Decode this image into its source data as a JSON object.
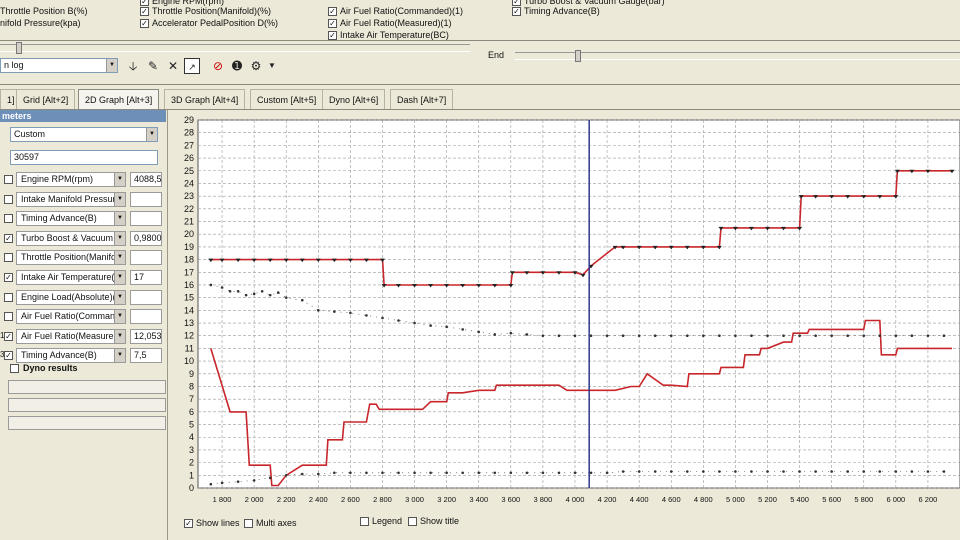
{
  "header_channels": [
    {
      "label": "Throttle Position B(%)",
      "checked": false,
      "col": 0,
      "row": 0
    },
    {
      "label": "nifold Pressure(kpa)",
      "checked": false,
      "col": 0,
      "row": 1
    },
    {
      "label": "Engine RPM(rpm)",
      "checked": true,
      "col": 1,
      "row": -1
    },
    {
      "label": "Throttle Position(Manifold)(%)",
      "checked": true,
      "col": 1,
      "row": 0
    },
    {
      "label": "Accelerator PedalPosition D(%)",
      "checked": true,
      "col": 1,
      "row": 1
    },
    {
      "label": "Air Fuel Ratio(Commanded)(1)",
      "checked": true,
      "col": 2,
      "row": 0
    },
    {
      "label": "Air Fuel Ratio(Measured)(1)",
      "checked": true,
      "col": 2,
      "row": 1
    },
    {
      "label": "Intake Air Temperature(BC)",
      "checked": true,
      "col": 2,
      "row": 2
    },
    {
      "label": "Turbo Boost & Vacuum Gauge(bar)",
      "checked": true,
      "col": 3,
      "row": -1
    },
    {
      "label": "Timing Advance(B)",
      "checked": true,
      "col": 3,
      "row": 0
    }
  ],
  "range": {
    "end_label": "End"
  },
  "log_select": {
    "value": "n log"
  },
  "tabs": [
    {
      "label": "1]",
      "active": false
    },
    {
      "label": "Grid [Alt+2]",
      "active": false
    },
    {
      "label": "2D Graph [Alt+3]",
      "active": true
    },
    {
      "label": "3D Graph [Alt+4]",
      "active": false
    },
    {
      "label": "Custom [Alt+5]",
      "active": false
    },
    {
      "label": "Dyno [Alt+6]",
      "active": false
    },
    {
      "label": "Dash [Alt+7]",
      "active": false
    }
  ],
  "panel": {
    "title": "meters",
    "preset": "Custom",
    "count": "30597",
    "params": [
      {
        "label": "Engine RPM(rpm)",
        "value": "4088,5",
        "checked": false,
        "mark": ""
      },
      {
        "label": "Intake Manifold Pressure",
        "value": "",
        "checked": false,
        "mark": ""
      },
      {
        "label": "Timing Advance(B)",
        "value": "",
        "checked": false,
        "mark": ""
      },
      {
        "label": "Turbo Boost & Vacuum",
        "value": "0,9800",
        "checked": true,
        "mark": ""
      },
      {
        "label": "Throttle Position(Manifo",
        "value": "",
        "checked": false,
        "mark": ""
      },
      {
        "label": "Intake Air Temperature(",
        "value": "17",
        "checked": true,
        "mark": ""
      },
      {
        "label": "Engine Load(Absolute)(%",
        "value": "",
        "checked": false,
        "mark": ""
      },
      {
        "label": "Air Fuel Ratio(Commanc",
        "value": "",
        "checked": false,
        "mark": ""
      },
      {
        "label": "Air Fuel Ratio(Measurer",
        "value": "12,053",
        "checked": true,
        "mark": "1"
      },
      {
        "label": "Timing Advance(B)",
        "value": "7,5",
        "checked": true,
        "mark": "3"
      }
    ],
    "dyno_label": "Dyno results"
  },
  "footer": {
    "show_lines": "Show lines",
    "multi_axes": "Multi axes",
    "legend": "Legend",
    "show_title": "Show title"
  },
  "chart_data": {
    "type": "line",
    "xlim": [
      1650,
      6400
    ],
    "ylim": [
      0,
      29
    ],
    "x_ticks": [
      "1 800",
      "2 000",
      "2 200",
      "2 400",
      "2 600",
      "2 800",
      "3 000",
      "3 200",
      "3 400",
      "3 600",
      "3 800",
      "4 000",
      "4 200",
      "4 400",
      "4 600",
      "4 800",
      "5 000",
      "5 200",
      "5 400",
      "5 600",
      "5 800",
      "6 000",
      "6 200"
    ],
    "x_tick_values": [
      1800,
      2000,
      2200,
      2400,
      2600,
      2800,
      3000,
      3200,
      3400,
      3600,
      3800,
      4000,
      4200,
      4400,
      4600,
      4800,
      5000,
      5200,
      5400,
      5600,
      5800,
      6000,
      6200
    ],
    "y_ticks": [
      0,
      1,
      2,
      3,
      4,
      5,
      6,
      7,
      8,
      9,
      10,
      11,
      12,
      13,
      14,
      15,
      16,
      17,
      18,
      19,
      20,
      21,
      22,
      23,
      24,
      25,
      26,
      27,
      28,
      29
    ],
    "cursor_x": 4088.5,
    "grid": true,
    "series": [
      {
        "style": "line-markers",
        "color": "#c8262b",
        "points": [
          [
            1730,
            18
          ],
          [
            1800,
            18
          ],
          [
            1900,
            18
          ],
          [
            2000,
            18
          ],
          [
            2100,
            18
          ],
          [
            2200,
            18
          ],
          [
            2300,
            18
          ],
          [
            2400,
            18
          ],
          [
            2500,
            18
          ],
          [
            2600,
            18
          ],
          [
            2700,
            18
          ],
          [
            2800,
            18
          ],
          [
            2810,
            16
          ],
          [
            2900,
            16
          ],
          [
            3000,
            16
          ],
          [
            3100,
            16
          ],
          [
            3200,
            16
          ],
          [
            3300,
            16
          ],
          [
            3400,
            16
          ],
          [
            3500,
            16
          ],
          [
            3600,
            16
          ],
          [
            3610,
            17
          ],
          [
            3700,
            17
          ],
          [
            3800,
            17
          ],
          [
            3900,
            17
          ],
          [
            4000,
            17
          ],
          [
            4050,
            16.8
          ],
          [
            4100,
            17.5
          ],
          [
            4250,
            19
          ],
          [
            4300,
            19
          ],
          [
            4400,
            19
          ],
          [
            4500,
            19
          ],
          [
            4600,
            19
          ],
          [
            4700,
            19
          ],
          [
            4800,
            19
          ],
          [
            4900,
            19
          ],
          [
            4910,
            20.5
          ],
          [
            5000,
            20.5
          ],
          [
            5100,
            20.5
          ],
          [
            5200,
            20.5
          ],
          [
            5300,
            20.5
          ],
          [
            5400,
            20.5
          ],
          [
            5410,
            23
          ],
          [
            5500,
            23
          ],
          [
            5600,
            23
          ],
          [
            5700,
            23
          ],
          [
            5800,
            23
          ],
          [
            5900,
            23
          ],
          [
            6000,
            23
          ],
          [
            6010,
            25
          ],
          [
            6100,
            25
          ],
          [
            6200,
            25
          ],
          [
            6350,
            25
          ]
        ]
      },
      {
        "style": "line",
        "color": "#c8262b",
        "points": [
          [
            1730,
            11
          ],
          [
            1850,
            6
          ],
          [
            1950,
            6
          ],
          [
            1970,
            1.8
          ],
          [
            2100,
            1.8
          ],
          [
            2110,
            0.2
          ],
          [
            2150,
            0.2
          ],
          [
            2200,
            1
          ],
          [
            2300,
            1.8
          ],
          [
            2450,
            1.8
          ],
          [
            2460,
            3.8
          ],
          [
            2550,
            3.8
          ],
          [
            2560,
            5.2
          ],
          [
            2700,
            5.2
          ],
          [
            2720,
            6.6
          ],
          [
            2760,
            6.6
          ],
          [
            2780,
            6.2
          ],
          [
            3050,
            6.2
          ],
          [
            3100,
            6.8
          ],
          [
            3200,
            6.8
          ],
          [
            3210,
            7.5
          ],
          [
            3300,
            7.5
          ],
          [
            3400,
            7.7
          ],
          [
            3500,
            7.7
          ],
          [
            3510,
            8.1
          ],
          [
            3900,
            8.1
          ],
          [
            3950,
            7.7
          ],
          [
            4250,
            7.7
          ],
          [
            4350,
            8
          ],
          [
            4400,
            8
          ],
          [
            4450,
            9
          ],
          [
            4550,
            8.1
          ],
          [
            4600,
            8.1
          ],
          [
            4700,
            8
          ],
          [
            4710,
            9
          ],
          [
            4900,
            9
          ],
          [
            4910,
            9.5
          ],
          [
            5050,
            9.5
          ],
          [
            5060,
            10.5
          ],
          [
            5150,
            10.5
          ],
          [
            5160,
            11
          ],
          [
            5200,
            11
          ],
          [
            5300,
            11.5
          ],
          [
            5350,
            11.5
          ],
          [
            5360,
            12.2
          ],
          [
            5450,
            12.2
          ],
          [
            5460,
            12.5
          ],
          [
            5800,
            12.5
          ],
          [
            5810,
            13.2
          ],
          [
            5900,
            13.2
          ],
          [
            5910,
            10.5
          ],
          [
            6000,
            10.5
          ],
          [
            6010,
            11
          ],
          [
            6350,
            11
          ]
        ]
      },
      {
        "style": "dotted",
        "color": "#333333",
        "points": [
          [
            1730,
            16
          ],
          [
            1800,
            15.8
          ],
          [
            1850,
            15.5
          ],
          [
            1900,
            15.5
          ],
          [
            1950,
            15.2
          ],
          [
            2000,
            15.3
          ],
          [
            2050,
            15.5
          ],
          [
            2100,
            15.2
          ],
          [
            2150,
            15.4
          ],
          [
            2200,
            15
          ],
          [
            2300,
            14.8
          ],
          [
            2400,
            14
          ],
          [
            2500,
            13.9
          ],
          [
            2600,
            13.8
          ],
          [
            2700,
            13.6
          ],
          [
            2800,
            13.4
          ],
          [
            2900,
            13.2
          ],
          [
            3000,
            13
          ],
          [
            3100,
            12.8
          ],
          [
            3200,
            12.7
          ],
          [
            3300,
            12.5
          ],
          [
            3400,
            12.3
          ],
          [
            3500,
            12.1
          ],
          [
            3600,
            12.2
          ],
          [
            3700,
            12.1
          ],
          [
            3800,
            12
          ],
          [
            3900,
            12
          ],
          [
            4000,
            12
          ],
          [
            4100,
            12
          ],
          [
            4200,
            12
          ],
          [
            4300,
            12
          ],
          [
            4400,
            12
          ],
          [
            4500,
            12
          ],
          [
            4600,
            12
          ],
          [
            4700,
            12
          ],
          [
            4800,
            12
          ],
          [
            4900,
            12
          ],
          [
            5000,
            12
          ],
          [
            5100,
            12
          ],
          [
            5200,
            12
          ],
          [
            5300,
            12
          ],
          [
            5400,
            12
          ],
          [
            5500,
            12
          ],
          [
            5600,
            12
          ],
          [
            5700,
            12
          ],
          [
            5800,
            12
          ],
          [
            5900,
            12
          ],
          [
            6000,
            12
          ],
          [
            6100,
            12
          ],
          [
            6200,
            12
          ],
          [
            6300,
            12
          ]
        ]
      },
      {
        "style": "dotted",
        "color": "#333333",
        "points": [
          [
            1730,
            0.3
          ],
          [
            1800,
            0.4
          ],
          [
            1900,
            0.5
          ],
          [
            2000,
            0.6
          ],
          [
            2100,
            0.8
          ],
          [
            2200,
            1
          ],
          [
            2300,
            1.1
          ],
          [
            2400,
            1.1
          ],
          [
            2500,
            1.2
          ],
          [
            2600,
            1.2
          ],
          [
            2700,
            1.2
          ],
          [
            2800,
            1.2
          ],
          [
            2900,
            1.2
          ],
          [
            3000,
            1.2
          ],
          [
            3100,
            1.2
          ],
          [
            3200,
            1.2
          ],
          [
            3300,
            1.2
          ],
          [
            3400,
            1.2
          ],
          [
            3500,
            1.2
          ],
          [
            3600,
            1.2
          ],
          [
            3700,
            1.2
          ],
          [
            3800,
            1.2
          ],
          [
            3900,
            1.2
          ],
          [
            4000,
            1.2
          ],
          [
            4100,
            1.2
          ],
          [
            4200,
            1.2
          ],
          [
            4300,
            1.3
          ],
          [
            4400,
            1.3
          ],
          [
            4500,
            1.3
          ],
          [
            4600,
            1.3
          ],
          [
            4700,
            1.3
          ],
          [
            4800,
            1.3
          ],
          [
            4900,
            1.3
          ],
          [
            5000,
            1.3
          ],
          [
            5100,
            1.3
          ],
          [
            5200,
            1.3
          ],
          [
            5300,
            1.3
          ],
          [
            5400,
            1.3
          ],
          [
            5500,
            1.3
          ],
          [
            5600,
            1.3
          ],
          [
            5700,
            1.3
          ],
          [
            5800,
            1.3
          ],
          [
            5900,
            1.3
          ],
          [
            6000,
            1.3
          ],
          [
            6100,
            1.3
          ],
          [
            6200,
            1.3
          ],
          [
            6300,
            1.3
          ]
        ]
      }
    ]
  }
}
